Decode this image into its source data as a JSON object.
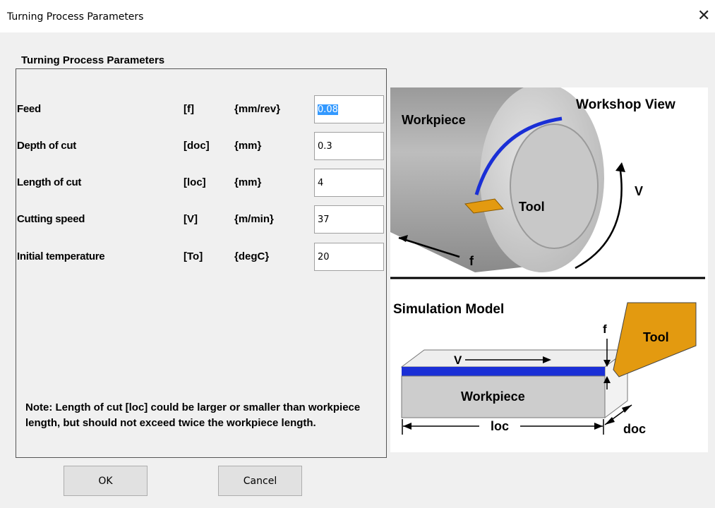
{
  "window": {
    "title": "Turning Process Parameters",
    "close_glyph": "✕"
  },
  "group": {
    "title": "Turning Process Parameters"
  },
  "parameters": [
    {
      "label": "Feed",
      "symbol": "[f]",
      "unit": "{mm/rev}",
      "value": "0.08"
    },
    {
      "label": "Depth of cut",
      "symbol": "[doc]",
      "unit": "{mm}",
      "value": "0.3"
    },
    {
      "label": "Length of cut",
      "symbol": "[loc]",
      "unit": "{mm}",
      "value": "4"
    },
    {
      "label": "Cutting speed",
      "symbol": "[V]",
      "unit": "{m/min}",
      "value": "37"
    },
    {
      "label": "Initial temperature",
      "symbol": "[To]",
      "unit": "{degC}",
      "value": "20"
    }
  ],
  "note": "Note: Length of cut [loc] could be larger or smaller than workpiece length, but should not exceed twice the workpiece length.",
  "buttons": {
    "ok": "OK",
    "cancel": "Cancel"
  },
  "diagram": {
    "workshop_title": "Workshop View",
    "workpiece_label": "Workpiece",
    "tool_label": "Tool",
    "v_label": "V",
    "f_label": "f",
    "sim_title": "Simulation Model",
    "sim_f_label": "f",
    "sim_tool_label": "Tool",
    "sim_v_label": "V",
    "sim_workpiece_label": "Workpiece",
    "loc_label": "loc",
    "doc_label": "doc"
  },
  "colors": {
    "chip_blue": "#1a2fd6",
    "tool_orange": "#e39a10",
    "workpiece_gray": "#cdcdcd",
    "selection": "#3399ff"
  }
}
